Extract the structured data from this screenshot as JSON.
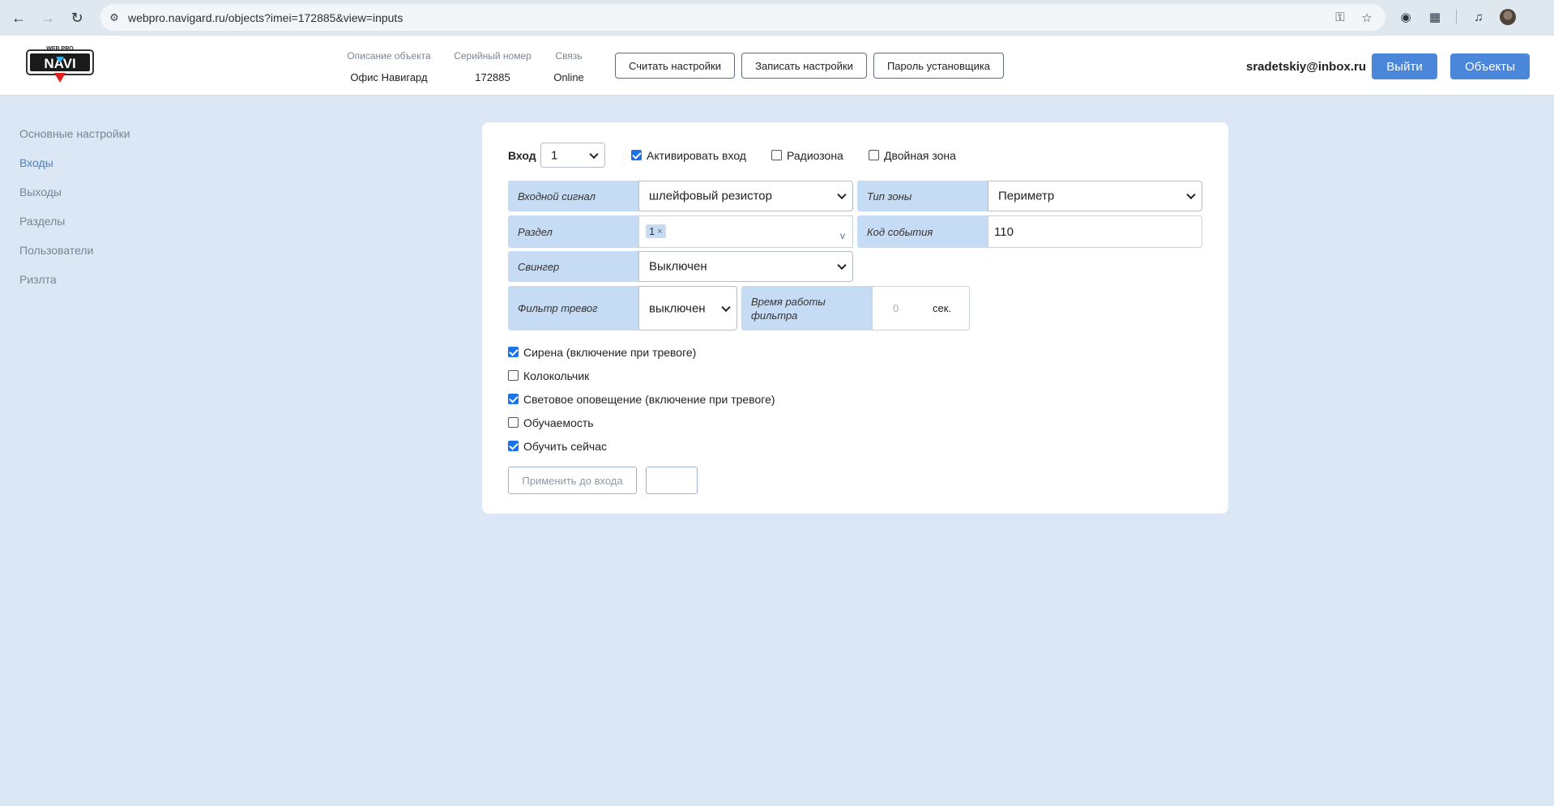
{
  "browser": {
    "url": "webpro.navigard.ru/objects?imei=172885&view=inputs"
  },
  "header": {
    "logo_text": "WEB PRO NAVI",
    "info": [
      {
        "label": "Описание объекта",
        "value": "Офис Навигард"
      },
      {
        "label": "Серийный номер",
        "value": "172885"
      },
      {
        "label": "Связь",
        "value": "Online"
      }
    ],
    "read_settings": "Считать настройки",
    "write_settings": "Записать настройки",
    "installer_password": "Пароль установщика",
    "user_email": "sradetskiy@inbox.ru",
    "logout": "Выйти",
    "objects": "Объекты",
    "accent_color": "#4a86d9"
  },
  "sidebar": {
    "items": [
      {
        "label": "Основные настройки",
        "active": false
      },
      {
        "label": "Входы",
        "active": true
      },
      {
        "label": "Выходы",
        "active": false
      },
      {
        "label": "Разделы",
        "active": false
      },
      {
        "label": "Пользователи",
        "active": false
      },
      {
        "label": "Ризлта",
        "active": false
      }
    ]
  },
  "form": {
    "input_label": "Вход",
    "input_value": "1",
    "activate_input": {
      "label": "Активировать вход",
      "checked": true
    },
    "radio_zone": {
      "label": "Радиозона",
      "checked": false
    },
    "double_zone": {
      "label": "Двойная зона",
      "checked": false
    },
    "input_signal": {
      "label": "Входной сигнал",
      "value": "шлейфовый резистор"
    },
    "zone_type": {
      "label": "Тип зоны",
      "value": "Периметр"
    },
    "partition": {
      "label": "Раздел",
      "tag": "1",
      "tag_remove": "×",
      "toggle": "v"
    },
    "event_code": {
      "label": "Код события",
      "value": "110"
    },
    "swinger": {
      "label": "Свингер",
      "value": "Выключен"
    },
    "alarm_filter": {
      "label": "Фильтр тревог",
      "value": "выключен"
    },
    "filter_time": {
      "label": "Время работы фильтра",
      "placeholder": "0",
      "unit": "сек."
    },
    "checkboxes": [
      {
        "label": "Сирена (включение при тревоге)",
        "checked": true
      },
      {
        "label": "Колокольчик",
        "checked": false
      },
      {
        "label": "Световое оповещение (включение при тревоге)",
        "checked": true
      },
      {
        "label": "Обучаемость",
        "checked": false
      },
      {
        "label": "Обучить сейчас",
        "checked": true
      }
    ],
    "apply_button": "Применить до входа",
    "apply_target": ""
  }
}
